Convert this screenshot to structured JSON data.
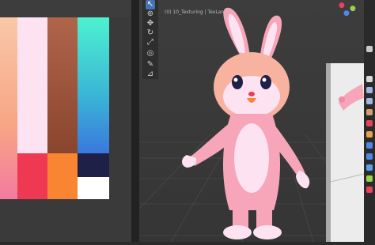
{
  "viewport": {
    "header_text": "(0) 10_Texturing | TexLand"
  },
  "palette": {
    "swatches": [
      {
        "name": "peach-gradient",
        "color": "#f7b69a"
      },
      {
        "name": "light-pink",
        "color": "#fde3f2"
      },
      {
        "name": "brown-gradient",
        "color": "#a95d3f"
      },
      {
        "name": "mint-blue-gradient",
        "color": "#4be7cf"
      },
      {
        "name": "pink-bottom",
        "color": "#f48aa6"
      },
      {
        "name": "red",
        "color": "#ef3852"
      },
      {
        "name": "orange",
        "color": "#f98432"
      },
      {
        "name": "navy",
        "color": "#1e2047"
      },
      {
        "name": "white",
        "color": "#ffffff"
      }
    ]
  },
  "tools": [
    {
      "icon": "select-cursor-icon",
      "glyph": "↖"
    },
    {
      "icon": "cursor-icon",
      "glyph": "⊕"
    },
    {
      "icon": "move-icon",
      "glyph": "✥"
    },
    {
      "icon": "rotate-icon",
      "glyph": "↻"
    },
    {
      "icon": "scale-icon",
      "glyph": "⤢"
    },
    {
      "icon": "transform-icon",
      "glyph": "◎"
    },
    {
      "icon": "annotate-icon",
      "glyph": "✎"
    },
    {
      "icon": "measure-icon",
      "glyph": "⊿"
    }
  ],
  "colors": {
    "accent": "#4772b3",
    "bunny_pink": "#f7a6b9",
    "bunny_body": "#fbd0e2"
  }
}
